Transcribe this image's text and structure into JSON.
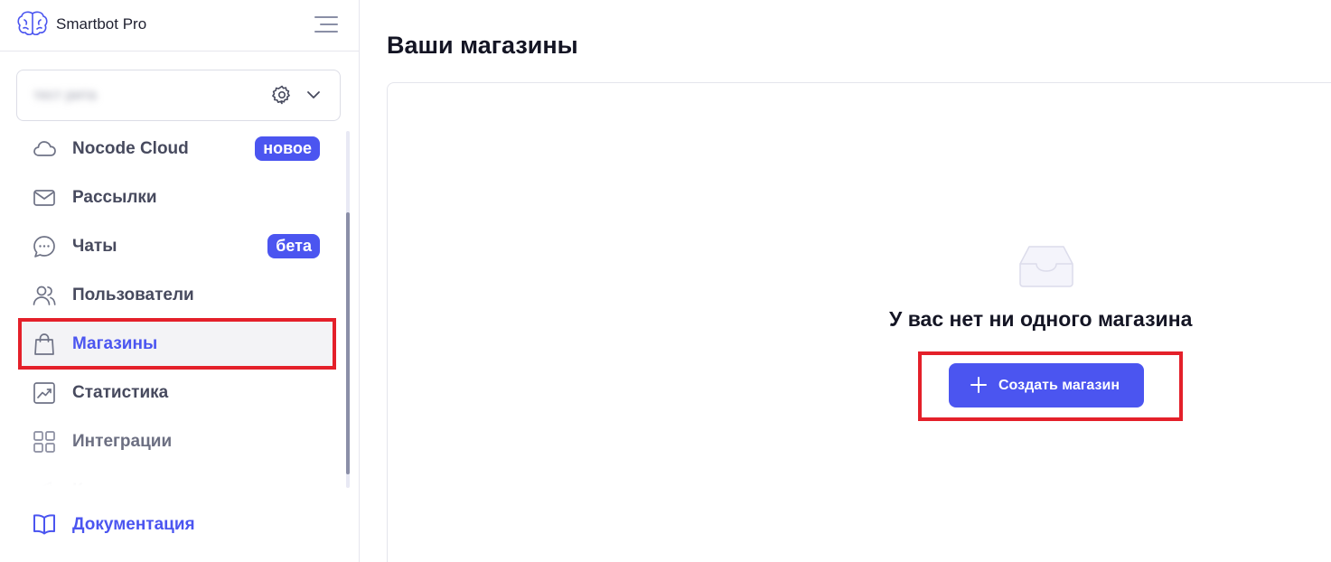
{
  "app": {
    "name": "Smartbot Pro",
    "logo_icon": "brain-icon",
    "menu_icon": "hamburger-menu-icon"
  },
  "project": {
    "name": "тест рита",
    "settings_icon": "gear-icon",
    "dropdown_icon": "chevron-down-icon"
  },
  "nav": {
    "items": [
      {
        "label": "Nocode Cloud",
        "icon": "cloud-icon",
        "badge": "новое"
      },
      {
        "label": "Рассылки",
        "icon": "mail-icon"
      },
      {
        "label": "Чаты",
        "icon": "chat-bubble-icon",
        "badge": "бета"
      },
      {
        "label": "Пользователи",
        "icon": "users-icon"
      },
      {
        "label": "Магазины",
        "icon": "shopping-bag-icon",
        "active": true
      },
      {
        "label": "Статистика",
        "icon": "chart-icon"
      },
      {
        "label": "Интеграции",
        "icon": "grid-icon"
      },
      {
        "label": "К",
        "icon": "megaphone-icon"
      }
    ],
    "docs": {
      "label": "Документация",
      "icon": "book-icon"
    }
  },
  "main": {
    "title": "Ваши магазины",
    "empty_state": {
      "icon": "inbox-icon",
      "text": "У вас нет ни одного магазина",
      "button_label": "Создать магазин",
      "button_icon": "plus-icon"
    }
  },
  "colors": {
    "accent": "#4b55f0",
    "highlight": "#e4202a",
    "text": "#474a5e"
  }
}
